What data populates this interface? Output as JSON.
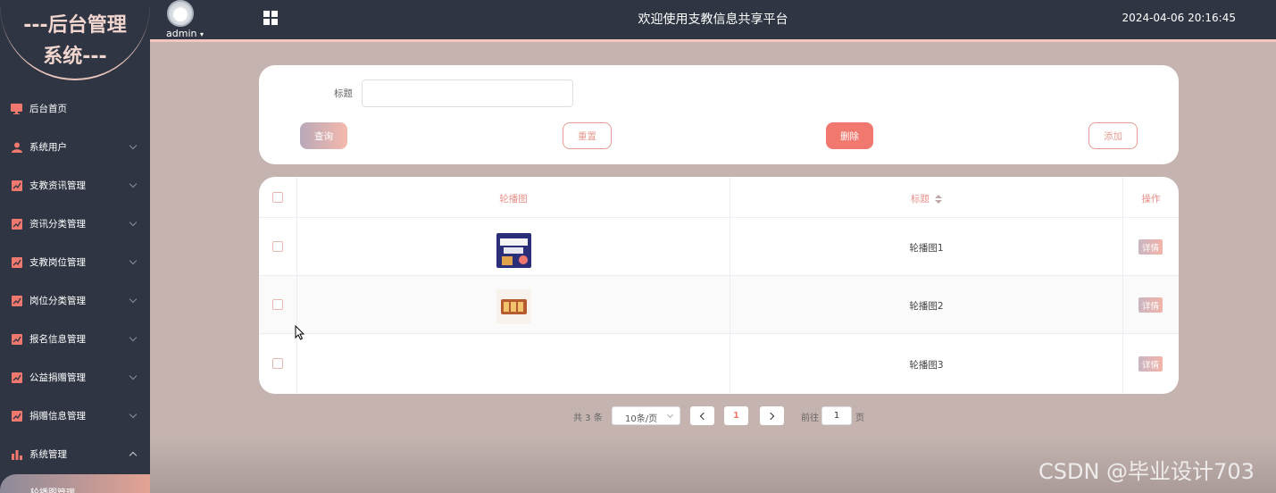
{
  "brand": {
    "line1": "---后台管理",
    "line2": "系统---"
  },
  "header": {
    "user": "admin",
    "title": "欢迎使用支教信息共享平台",
    "datetime": "2024-04-06 20:16:45"
  },
  "sidebar": {
    "items": [
      {
        "label": "后台首页",
        "icon": "monitor-icon"
      },
      {
        "label": "系统用户",
        "icon": "user-icon"
      },
      {
        "label": "支教资讯管理",
        "icon": "chart-line-icon"
      },
      {
        "label": "资讯分类管理",
        "icon": "chart-line-icon"
      },
      {
        "label": "支教岗位管理",
        "icon": "chart-line-icon"
      },
      {
        "label": "岗位分类管理",
        "icon": "chart-line-icon"
      },
      {
        "label": "报名信息管理",
        "icon": "chart-line-icon"
      },
      {
        "label": "公益捐赠管理",
        "icon": "chart-line-icon"
      },
      {
        "label": "捐赠信息管理",
        "icon": "chart-line-icon"
      },
      {
        "label": "系统管理",
        "icon": "bar-chart-icon"
      }
    ],
    "active_sub": "轮播图管理"
  },
  "search": {
    "title_label": "标题",
    "title_value": "",
    "query": "查询",
    "reset": "重置",
    "delete": "删除",
    "add": "添加"
  },
  "table": {
    "headers": {
      "image": "轮播图",
      "title": "标题",
      "action": "操作"
    },
    "rows": [
      {
        "title": "轮播图1",
        "action": "详情"
      },
      {
        "title": "轮播图2",
        "action": "详情"
      },
      {
        "title": "轮播图3",
        "action": "详情"
      }
    ]
  },
  "pagination": {
    "total": "共 3 条",
    "page_size": "10条/页",
    "current": "1",
    "goto_label": "前往",
    "goto_value": "1",
    "goto_unit": "页"
  },
  "colors": {
    "sidebar": "#2f3542",
    "accent": "#f0786e",
    "background": "#c4b3af"
  },
  "watermark": "CSDN @毕业设计703"
}
